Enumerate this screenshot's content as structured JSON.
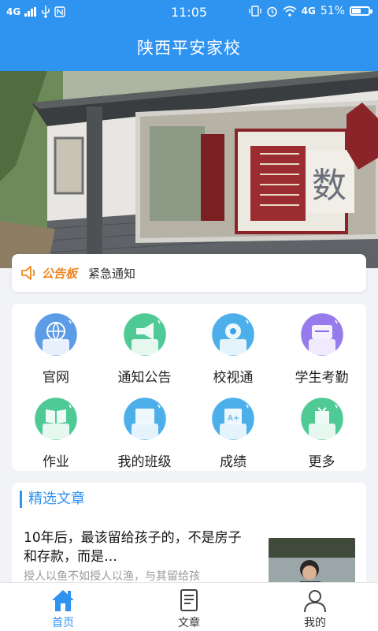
{
  "status_bar": {
    "network_left": "4G",
    "time": "11:05",
    "network_right": "4G",
    "battery": "51%",
    "battery_level": 0.51
  },
  "header": {
    "title": "陕西平安家校"
  },
  "banner": {
    "mural_text": "数"
  },
  "notice": {
    "label": "公告板",
    "text": "紧急通知"
  },
  "grid": {
    "items": [
      {
        "label": "官网",
        "icon": "globe-icon",
        "color": "#4a90e2"
      },
      {
        "label": "通知公告",
        "icon": "megaphone-icon",
        "color": "#3cc48a"
      },
      {
        "label": "校视通",
        "icon": "camera-icon",
        "color": "#3aa6e8"
      },
      {
        "label": "学生考勤",
        "icon": "attendance-icon",
        "color": "#8a6de9"
      },
      {
        "label": "作业",
        "icon": "book-icon",
        "color": "#3cc48a"
      },
      {
        "label": "我的班级",
        "icon": "class-icon",
        "color": "#3aa6e8"
      },
      {
        "label": "成绩",
        "icon": "grades-icon",
        "color": "#3aa6e8"
      },
      {
        "label": "更多",
        "icon": "more-icon",
        "color": "#3cc48a"
      }
    ]
  },
  "articles": {
    "header": "精选文章",
    "items": [
      {
        "title": "10年后，最该留给孩子的，不是房子和存款，而是…",
        "desc": "授人以鱼不如授人以渔，与其留给孩"
      }
    ]
  },
  "bottom_nav": {
    "items": [
      {
        "label": "首页",
        "icon": "home-icon",
        "active": true
      },
      {
        "label": "文章",
        "icon": "article-icon",
        "active": false
      },
      {
        "label": "我的",
        "icon": "profile-icon",
        "active": false
      }
    ]
  },
  "colors": {
    "primary": "#2f93f0",
    "notice_accent": "#f0851e"
  }
}
